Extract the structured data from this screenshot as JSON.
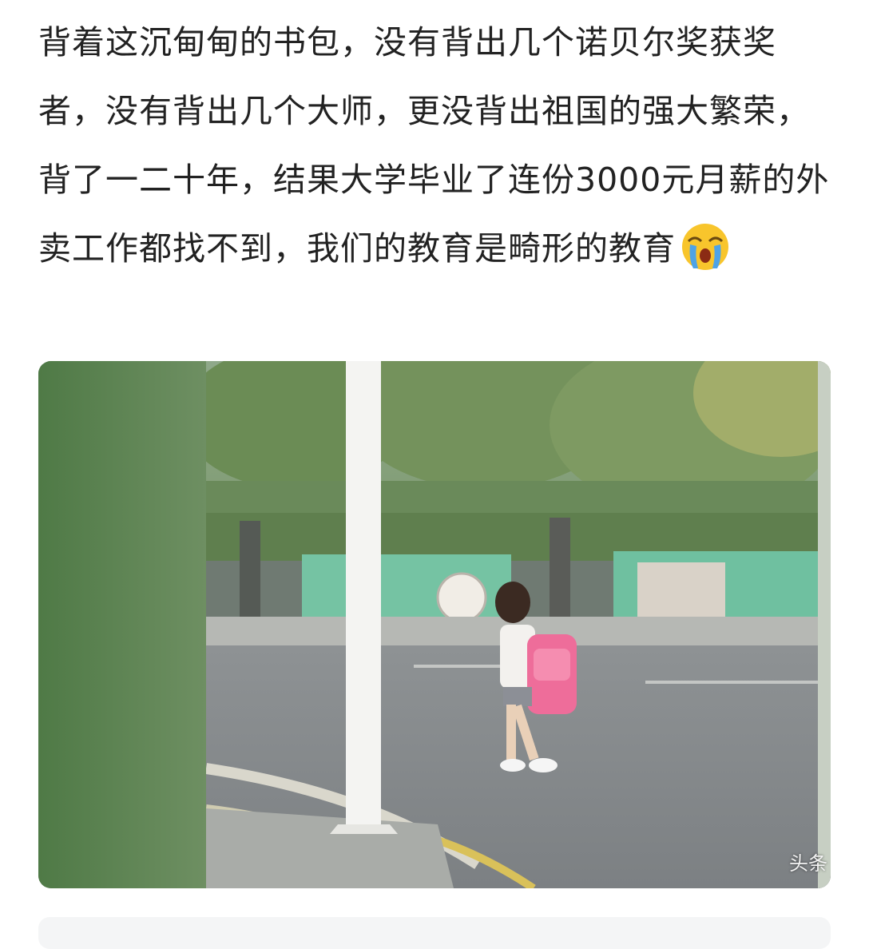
{
  "post": {
    "text": "背着这沉甸甸的书包，没有背出几个诺贝尔奖获奖者，没有背出几个大师，更没背出祖国的强大繁荣，背了一二十年，结果大学毕业了连份3000元月薪的外卖工作都找不到，我们的教育是畸形的教育",
    "emoji": "crying-face-emoji"
  },
  "media": {
    "watermark": "头条",
    "description_icon": "photo-frame"
  }
}
